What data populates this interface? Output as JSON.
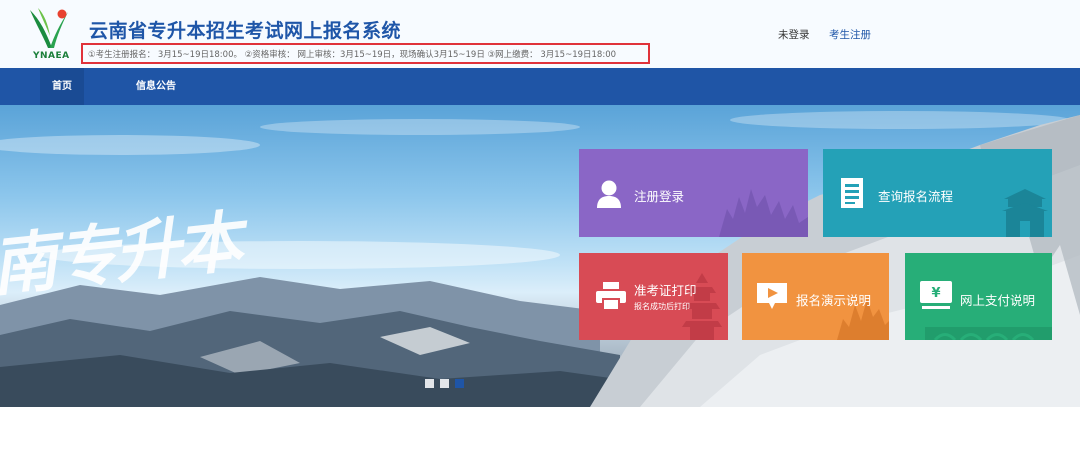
{
  "header": {
    "title": "云南省专升本招生考试网上报名系统",
    "logo_text": "YNAEA",
    "notice": "①考生注册报名：  3月15~19日18:00。  ②资格审核：  网上审核：3月15~19日，现场确认3月15~19日  ③网上缴费：  3月15~19日18:00",
    "login_status": "未登录",
    "register_link": "考生注册"
  },
  "nav": {
    "items": [
      {
        "label": "首页",
        "active": true
      },
      {
        "label": "信息公告",
        "active": false
      }
    ]
  },
  "banner": {
    "calligraphy": "南专升本",
    "carousel": {
      "count": 3,
      "active_index": 2
    }
  },
  "tiles": [
    {
      "label": "注册登录",
      "icon": "user-icon",
      "color": "#8a66c6"
    },
    {
      "label": "查询报名流程",
      "icon": "document-icon",
      "color": "#24a1b7"
    },
    {
      "label": "准考证打印",
      "sublabel": "报名成功后打印",
      "icon": "printer-icon",
      "color": "#d84b55"
    },
    {
      "label": "报名演示说明",
      "icon": "play-icon",
      "color": "#f19340"
    },
    {
      "label": "网上支付说明",
      "icon": "yen-icon",
      "color": "#27ae78"
    }
  ],
  "colors": {
    "brand_blue": "#1f55a6",
    "notice_border": "#e0323a",
    "title_blue": "#1f56a8"
  }
}
